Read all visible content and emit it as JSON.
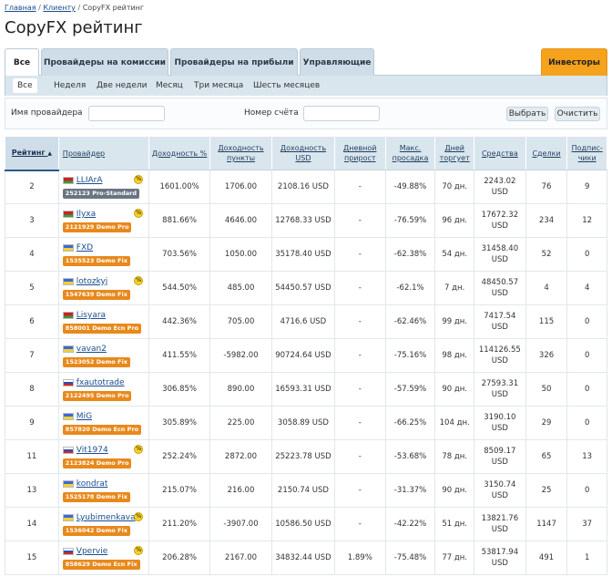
{
  "breadcrumb": {
    "home": "Главная",
    "clients": "Клиенту",
    "current": "CopyFX рейтинг",
    "sep": "/"
  },
  "title": "CopyFX рейтинг",
  "tabs": [
    {
      "label": "Все",
      "active": true
    },
    {
      "label": "Провайдеры на комиссии"
    },
    {
      "label": "Провайдеры на прибыли"
    },
    {
      "label": "Управляющие"
    },
    {
      "label": "Инвесторы"
    }
  ],
  "period_tabs": [
    {
      "label": "Все",
      "active": true
    },
    {
      "label": "Неделя"
    },
    {
      "label": "Две недели"
    },
    {
      "label": "Месяц"
    },
    {
      "label": "Три месяца"
    },
    {
      "label": "Шесть месяцев"
    }
  ],
  "filters": {
    "provider_label": "Имя провайдера",
    "provider_value": "",
    "account_label": "Номер счёта",
    "account_value": "",
    "select_button": "Выбрать",
    "clear_button": "Очистить"
  },
  "columns": {
    "rank": "Рейтинг",
    "provider": "Провайдер",
    "yield_pct": "Доходность %",
    "yield_points": "Доходность пункты",
    "yield_usd": "Доходность USD",
    "daily": "Дневной прирост",
    "drawdown": "Макс. просадка",
    "days": "Дней торгует",
    "funds": "Средства",
    "deals": "Сделки",
    "subs": "Подпис-чики"
  },
  "sort_arrow": "▲",
  "rows": [
    {
      "rank": "2",
      "flag": "by",
      "name": "LLIArA",
      "badge": "252123 Pro-Standard",
      "badge_color": "grey",
      "coin": true,
      "yield_pct": "1601.00%",
      "yield_points": "1706.00",
      "yield_usd": "2108.16 USD",
      "daily": "-",
      "drawdown": "-49.88%",
      "days": "70 дн.",
      "funds": "2243.02 USD",
      "deals": "76",
      "subs": "9"
    },
    {
      "rank": "3",
      "flag": "by",
      "name": "Ilyxa",
      "badge": "2121929 Demo Pro",
      "badge_color": "orange",
      "coin": true,
      "yield_pct": "881.66%",
      "yield_points": "4646.00",
      "yield_usd": "12768.33 USD",
      "daily": "-",
      "drawdown": "-76.59%",
      "days": "96 дн.",
      "funds": "17672.32 USD",
      "deals": "234",
      "subs": "12"
    },
    {
      "rank": "4",
      "flag": "ua",
      "name": "FXD",
      "badge": "1535523 Demo Fix",
      "badge_color": "orange",
      "coin": false,
      "yield_pct": "703.56%",
      "yield_points": "1050.00",
      "yield_usd": "35178.40 USD",
      "daily": "-",
      "drawdown": "-62.38%",
      "days": "54 дн.",
      "funds": "31458.40 USD",
      "deals": "52",
      "subs": "0"
    },
    {
      "rank": "5",
      "flag": "ua",
      "name": "lotozkyj",
      "badge": "1547639 Demo Fix",
      "badge_color": "orange",
      "coin": true,
      "yield_pct": "544.50%",
      "yield_points": "485.00",
      "yield_usd": "54450.57 USD",
      "daily": "-",
      "drawdown": "-62.1%",
      "days": "7 дн.",
      "funds": "48450.57 USD",
      "deals": "4",
      "subs": "4"
    },
    {
      "rank": "6",
      "flag": "by",
      "name": "Lisyara",
      "badge": "858001 Demo Ecn Pro",
      "badge_color": "orange",
      "coin": false,
      "yield_pct": "442.36%",
      "yield_points": "705.00",
      "yield_usd": "4716.6 USD",
      "daily": "-",
      "drawdown": "-62.46%",
      "days": "99 дн.",
      "funds": "7417.54 USD",
      "deals": "115",
      "subs": "0"
    },
    {
      "rank": "7",
      "flag": "ua",
      "name": "vavan2",
      "badge": "1523052 Demo Fix",
      "badge_color": "orange",
      "coin": false,
      "yield_pct": "411.55%",
      "yield_points": "-5982.00",
      "yield_usd": "90724.64 USD",
      "daily": "-",
      "drawdown": "-75.16%",
      "days": "98 дн.",
      "funds": "114126.55 USD",
      "deals": "326",
      "subs": "0"
    },
    {
      "rank": "8",
      "flag": "ru",
      "name": "fxautotrade",
      "badge": "2122495 Demo Pro",
      "badge_color": "orange",
      "coin": false,
      "yield_pct": "306.85%",
      "yield_points": "890.00",
      "yield_usd": "16593.31 USD",
      "daily": "-",
      "drawdown": "-57.59%",
      "days": "90 дн.",
      "funds": "27593.31 USD",
      "deals": "50",
      "subs": "0"
    },
    {
      "rank": "9",
      "flag": "ua",
      "name": "MiG",
      "badge": "857820 Demo Ecn Pro",
      "badge_color": "orange",
      "coin": false,
      "yield_pct": "305.89%",
      "yield_points": "225.00",
      "yield_usd": "3058.89 USD",
      "daily": "-",
      "drawdown": "-66.25%",
      "days": "104 дн.",
      "funds": "3190.10 USD",
      "deals": "29",
      "subs": "0"
    },
    {
      "rank": "11",
      "flag": "ru",
      "name": "Vit1974",
      "badge": "2123824 Demo Pro",
      "badge_color": "orange",
      "coin": true,
      "yield_pct": "252.24%",
      "yield_points": "2872.00",
      "yield_usd": "25223.78 USD",
      "daily": "-",
      "drawdown": "-53.68%",
      "days": "78 дн.",
      "funds": "8509.17 USD",
      "deals": "65",
      "subs": "13"
    },
    {
      "rank": "13",
      "flag": "ua",
      "name": "kondrat",
      "badge": "1525178 Demo Fix",
      "badge_color": "orange",
      "coin": false,
      "yield_pct": "215.07%",
      "yield_points": "216.00",
      "yield_usd": "2150.74 USD",
      "daily": "-",
      "drawdown": "-31.37%",
      "days": "90 дн.",
      "funds": "3150.74 USD",
      "deals": "25",
      "subs": "0"
    },
    {
      "rank": "14",
      "flag": "ua",
      "name": "Lyubimenkava",
      "badge": "1536042 Demo Fix",
      "badge_color": "orange",
      "coin": true,
      "yield_pct": "211.20%",
      "yield_points": "-3907.00",
      "yield_usd": "10586.50 USD",
      "daily": "-",
      "drawdown": "-42.22%",
      "days": "51 дн.",
      "funds": "13821.76 USD",
      "deals": "1147",
      "subs": "37"
    },
    {
      "rank": "15",
      "flag": "ru",
      "name": "Vpervie",
      "badge": "858629 Demo Ecn Fix",
      "badge_color": "orange",
      "coin": true,
      "yield_pct": "206.28%",
      "yield_points": "2167.00",
      "yield_usd": "34832.44 USD",
      "daily": "1.89%",
      "drawdown": "-75.48%",
      "days": "77 дн.",
      "funds": "53817.94 USD",
      "deals": "491",
      "subs": "1"
    }
  ]
}
